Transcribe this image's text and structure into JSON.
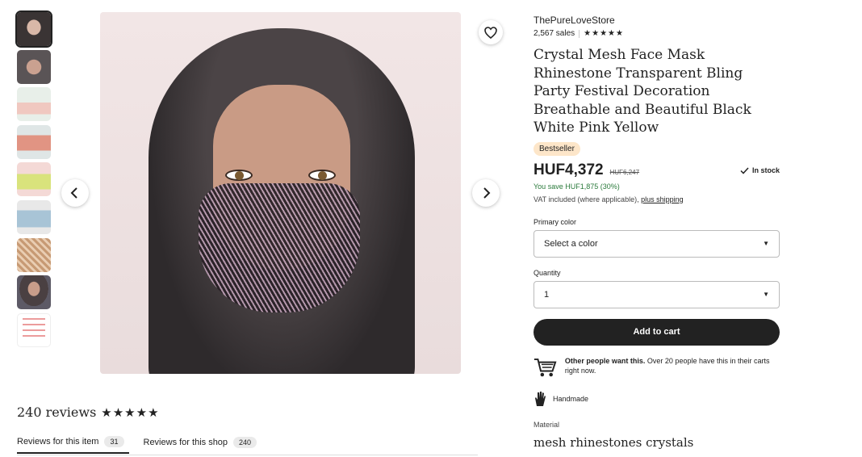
{
  "shop": {
    "name": "ThePureLoveStore",
    "sales": "2,567 sales",
    "rating_stars": "★★★★★"
  },
  "product": {
    "title": "Crystal Mesh Face Mask Rhinestone Transparent Bling Party Festival Decoration Breathable and Beautiful Black White Pink Yellow",
    "badge": "Bestseller",
    "price": "HUF4,372",
    "old_price": "HUF6,247",
    "stock": "In stock",
    "savings": "You save HUF1,875 (30%)",
    "vat_text": "VAT included (where applicable),",
    "shipping_link": "plus shipping"
  },
  "options": {
    "color_label": "Primary color",
    "color_value": "Select a color",
    "quantity_label": "Quantity",
    "quantity_value": "1",
    "add_to_cart": "Add to cart"
  },
  "demand": {
    "bold": "Other people want this.",
    "text": " Over 20 people have this in their carts right now."
  },
  "details": {
    "handmade": "Handmade",
    "material_label": "Material",
    "material_value": "mesh rhinestones crystals"
  },
  "reviews": {
    "title": "240 reviews",
    "stars": "★★★★★",
    "tabs": [
      {
        "label": "Reviews for this item",
        "count": "31"
      },
      {
        "label": "Reviews for this shop",
        "count": "240"
      }
    ]
  },
  "gallery": {
    "thumb_text": "ATTENTION",
    "thumb_count": 9
  }
}
